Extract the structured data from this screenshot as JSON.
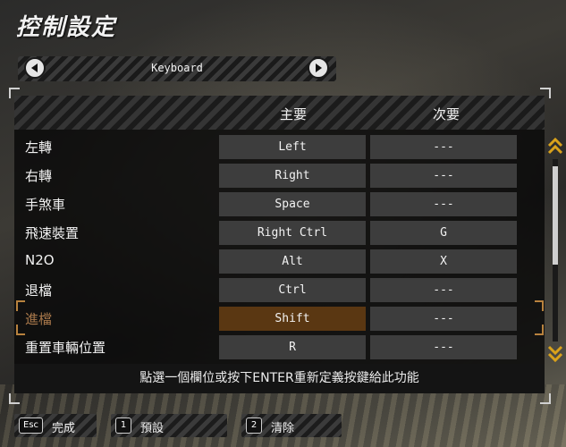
{
  "title": "控制設定",
  "device": {
    "label": "Keyboard"
  },
  "columns": {
    "primary": "主要",
    "secondary": "次要"
  },
  "rows": [
    {
      "action": "左轉",
      "primary": "Left",
      "secondary": "---"
    },
    {
      "action": "右轉",
      "primary": "Right",
      "secondary": "---"
    },
    {
      "action": "手煞車",
      "primary": "Space",
      "secondary": "---"
    },
    {
      "action": "飛速裝置",
      "primary": "Right Ctrl",
      "secondary": "G"
    },
    {
      "action": "N2O",
      "primary": "Alt",
      "secondary": "X"
    },
    {
      "action": "退檔",
      "primary": "Ctrl",
      "secondary": "---"
    },
    {
      "action": "進檔",
      "primary": "Shift",
      "secondary": "---",
      "selected": true
    },
    {
      "action": "重置車輛位置",
      "primary": "R",
      "secondary": "---"
    }
  ],
  "hint": "點選一個欄位或按下ENTER重新定義按鍵給此功能",
  "buttons": [
    {
      "key": "Esc",
      "label": "完成"
    },
    {
      "key": "1",
      "label": "預設"
    },
    {
      "key": "2",
      "label": "清除"
    }
  ],
  "colors": {
    "selected_key_bg": "#5a3712",
    "selected_label": "#a7774a",
    "scroll_arrow": "#d9a21b"
  },
  "icons": {
    "prev": "arrow-left-icon",
    "next": "arrow-right-icon",
    "scroll_up": "double-chevron-up-icon",
    "scroll_down": "double-chevron-down-icon"
  }
}
